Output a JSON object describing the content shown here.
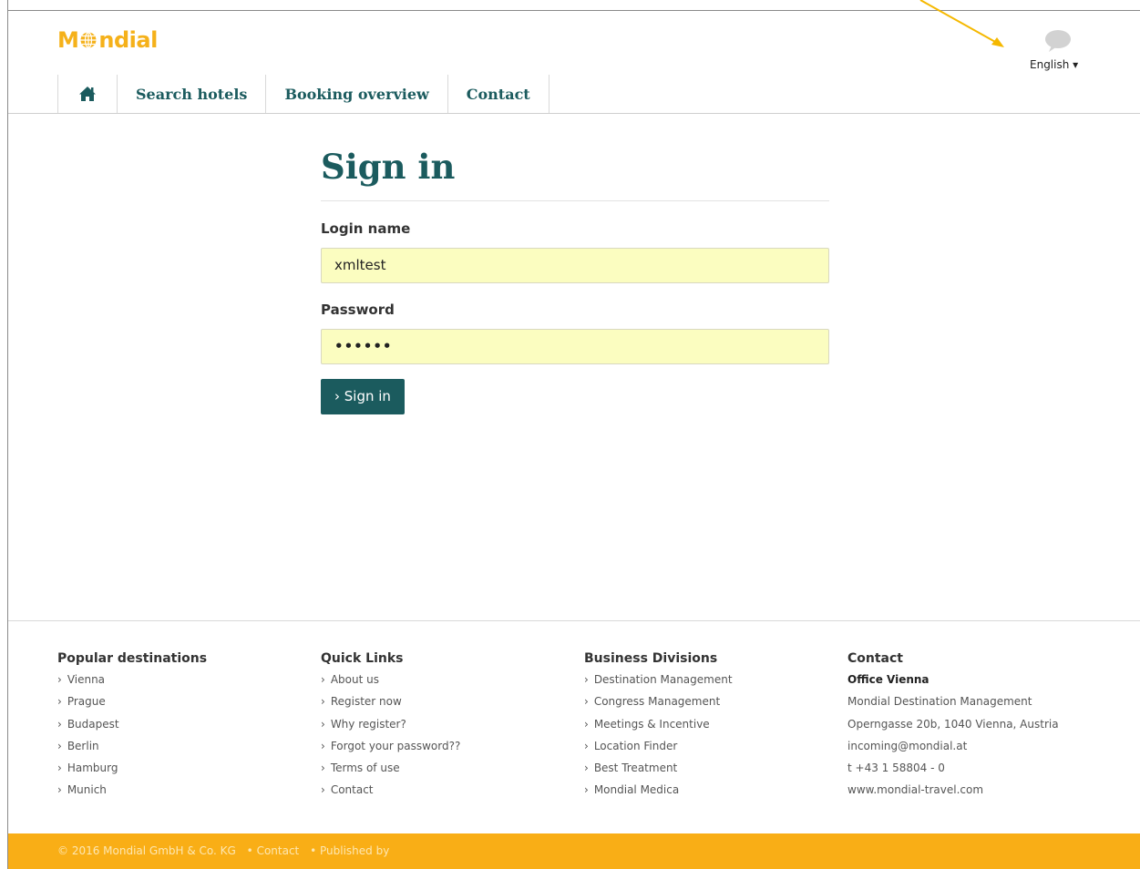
{
  "brand": {
    "logo_text_1": "M",
    "logo_text_2": "ndial",
    "color_accent": "#f5b11a",
    "color_primary": "#1b5b5e"
  },
  "language": {
    "label": "English ▾",
    "icon": "speech-bubble-icon"
  },
  "nav": {
    "home_icon": "home-icon",
    "items": [
      {
        "label": "Search hotels"
      },
      {
        "label": "Booking overview"
      },
      {
        "label": "Contact"
      }
    ]
  },
  "signin": {
    "title": "Sign in",
    "login_label": "Login name",
    "login_value": "xmltest",
    "password_label": "Password",
    "password_value": "••••••",
    "button_label": "› Sign in"
  },
  "footer": {
    "columns": [
      {
        "heading": "Popular destinations",
        "items": [
          "Vienna",
          "Prague",
          "Budapest",
          "Berlin",
          "Hamburg",
          "Munich"
        ]
      },
      {
        "heading": "Quick Links",
        "items": [
          "About us",
          "Register now",
          "Why register?",
          "Forgot your password??",
          "Terms of use",
          "Contact"
        ]
      },
      {
        "heading": "Business Divisions",
        "items": [
          "Destination Management",
          "Congress Management",
          "Meetings & Incentive",
          "Location Finder",
          "Best Treatment",
          "Mondial Medica"
        ]
      },
      {
        "heading": "Contact",
        "office": "Office Vienna",
        "lines": [
          "Mondial Destination Management",
          "Operngasse 20b, 1040 Vienna, Austria",
          "incoming@mondial.at",
          "t +43 1 58804 - 0",
          "www.mondial-travel.com"
        ]
      }
    ],
    "copyright": "© 2016 Mondial GmbH & Co. KG",
    "copy_links": [
      "• Contact",
      "• Published by"
    ]
  }
}
